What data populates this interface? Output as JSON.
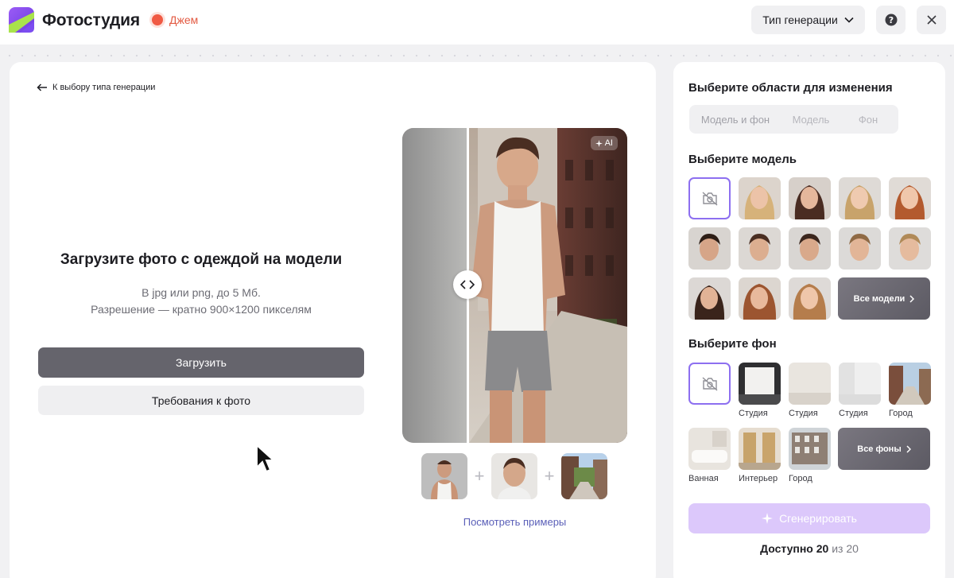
{
  "header": {
    "app_title": "Фотостудия",
    "brand": "Джем",
    "generation_type_label": "Тип генерации",
    "help_icon": "question-circle-icon",
    "close_icon": "close-icon",
    "brand_color": "#f05a44"
  },
  "left": {
    "back_link": "К выбору типа генерации",
    "upload_title": "Загрузите фото с одеждой на модели",
    "upload_sub_1": "В jpg или png, до 5 Мб.",
    "upload_sub_2": "Разрешение — кратно 900×1200 пикселям",
    "upload_button": "Загрузить",
    "requirements_button": "Требования к фото",
    "ai_badge": "AI",
    "examples_link": "Посмотреть примеры"
  },
  "right": {
    "areas_title": "Выберите области для изменения",
    "areas_tabs": [
      "Модель и фон",
      "Модель",
      "Фон"
    ],
    "model_title": "Выберите модель",
    "all_models": "Все модели",
    "background_title": "Выберите фон",
    "backgrounds": [
      "Студия",
      "Студия",
      "Студия",
      "Город",
      "Ванная",
      "Интерьер",
      "Город"
    ],
    "all_backgrounds": "Все фоны",
    "generate_button": "Сгенерировать",
    "available_label": "Доступно",
    "available_count": "20",
    "available_of": "из 20",
    "accent_color": "#8d6ff0",
    "generate_color": "#dcc8fb"
  }
}
